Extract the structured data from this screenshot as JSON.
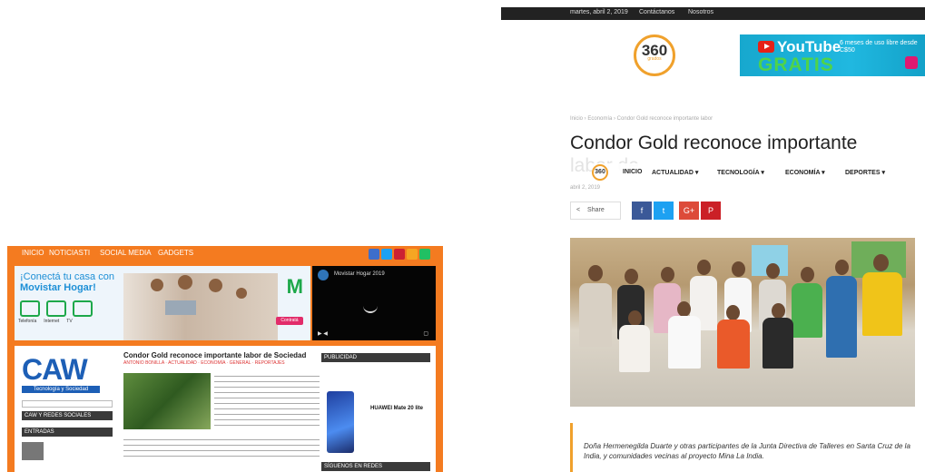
{
  "left_page": {
    "nav": [
      "INICIO",
      "NOTICIAS",
      "TI",
      "SOCIAL MEDIA",
      "GADGETS"
    ],
    "banner": {
      "headline_1": "¡Conectá tu casa con",
      "headline_2": "Movistar Hogar!",
      "icon_labels": [
        "Telefonía",
        "Internet",
        "TV"
      ],
      "brand": "M",
      "cta": "Contratá"
    },
    "video": {
      "title": "Movistar Hogar 2019",
      "controls_left": "▶  ◀",
      "controls_right": "▢"
    },
    "logo": "CAW",
    "logo_sub": "Tecnología y Sociedad",
    "left_boxes": [
      "CAW Y REDES SOCIALES",
      "ENTRADAS"
    ],
    "article_title": "Condor Gold reconoce importante labor de Sociedad",
    "article_meta": "ANTONIO BONILLA · ACTUALIDAD · ECONOMÍA · GENERAL · REPORTAJES",
    "right_boxes": [
      "PUBLICIDAD",
      "SÍGUENOS EN REDES"
    ],
    "phone_ad": "HUAWEI Mate 20 lite"
  },
  "right_page": {
    "topbar_date": "martes, abril 2, 2019",
    "topbar_links": [
      "Contáctanos",
      "Nosotros"
    ],
    "logo_main": "360",
    "logo_sub": "grados",
    "ad": {
      "brand": "YouTube",
      "promo": "GRATIS",
      "side_text": "6 meses de uso libre desde C$50"
    },
    "breadcrumbs": "Inicio › Economía › Condor Gold reconoce importante labor",
    "headline": "Condor Gold reconoce importante",
    "headline_ghost": "labor de",
    "nav": {
      "logo": "360",
      "items": [
        "INICIO",
        "ACTUALIDAD ▾",
        "TECNOLOGÍA ▾",
        "ECONOMÍA ▾",
        "DEPORTES ▾"
      ]
    },
    "date": "abril 2, 2019",
    "share_label": "Share",
    "share_buttons": [
      {
        "name": "facebook-icon",
        "glyph": "f",
        "color": "#3b5998"
      },
      {
        "name": "twitter-icon",
        "glyph": "t",
        "color": "#1da1f2"
      },
      {
        "name": "googleplus-icon",
        "glyph": "G+",
        "color": "#dd4b39"
      },
      {
        "name": "pinterest-icon",
        "glyph": "P",
        "color": "#cb2027"
      }
    ],
    "quote": "Doña Hermenegilda Duarte y otras participantes de la Junta Directiva de Talleres en Santa Cruz de la India, y comunidades vecinas al proyecto Mina La India."
  }
}
